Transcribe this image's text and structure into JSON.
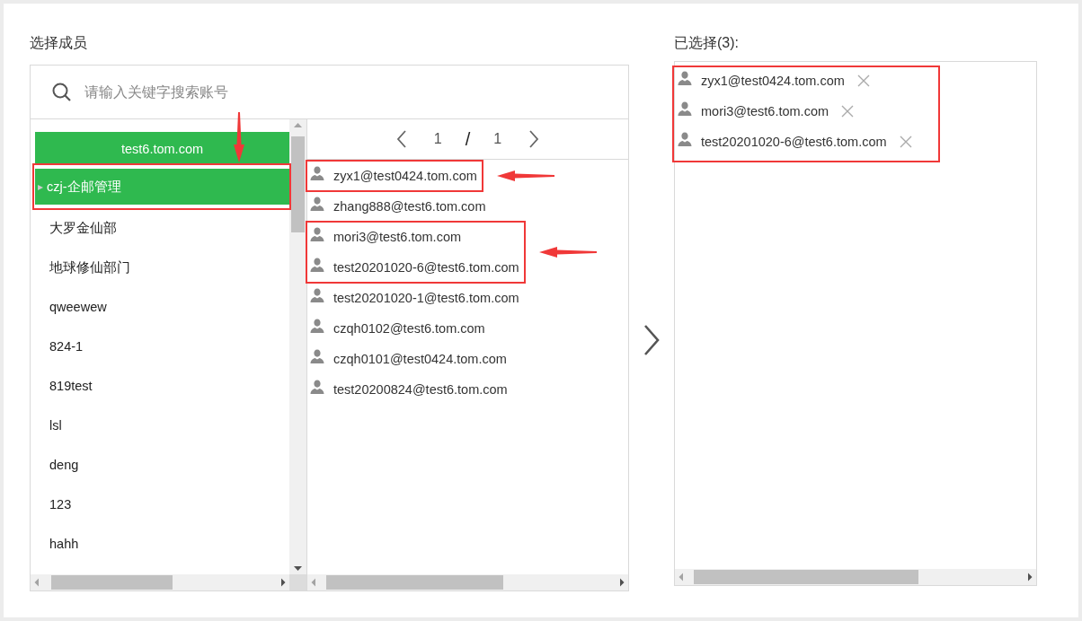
{
  "member_picker": {
    "title": "选择成员",
    "search": {
      "placeholder": "请输入关键字搜索账号"
    },
    "domain": {
      "label": "test6.tom.com",
      "annotated": true
    },
    "departments": [
      {
        "label": "czj-企邮管理",
        "selected": true,
        "annotated": true,
        "expander": "▸"
      },
      {
        "label": "大罗金仙部",
        "selected": false,
        "annotated": false
      },
      {
        "label": "地球修仙部门",
        "selected": false,
        "annotated": false
      },
      {
        "label": "qweewew",
        "selected": false,
        "annotated": false
      },
      {
        "label": "824-1",
        "selected": false,
        "annotated": false
      },
      {
        "label": "819test",
        "selected": false,
        "annotated": false
      },
      {
        "label": "lsl",
        "selected": false,
        "annotated": false
      },
      {
        "label": "deng",
        "selected": false,
        "annotated": false
      },
      {
        "label": "123",
        "selected": false,
        "annotated": false
      },
      {
        "label": "hahh",
        "selected": false,
        "annotated": false
      }
    ],
    "pager": {
      "current": "1",
      "separator": "/",
      "total": "1"
    },
    "members": [
      {
        "email": "zyx1@test0424.tom.com",
        "annotated": true
      },
      {
        "email": "zhang888@test6.tom.com",
        "annotated": false
      },
      {
        "email": "mori3@test6.tom.com",
        "annotated": true
      },
      {
        "email": "test20201020-6@test6.tom.com",
        "annotated": true
      },
      {
        "email": "test20201020-1@test6.tom.com",
        "annotated": false
      },
      {
        "email": "czqh0102@test6.tom.com",
        "annotated": false
      },
      {
        "email": "czqh0101@test0424.tom.com",
        "annotated": false
      },
      {
        "email": "test20200824@test6.tom.com",
        "annotated": false
      }
    ]
  },
  "selected_panel": {
    "title": "已选择(3):",
    "annotated": true,
    "items": [
      {
        "email": "zyx1@test0424.tom.com"
      },
      {
        "email": "mori3@test6.tom.com"
      },
      {
        "email": "test20201020-6@test6.tom.com"
      }
    ]
  }
}
